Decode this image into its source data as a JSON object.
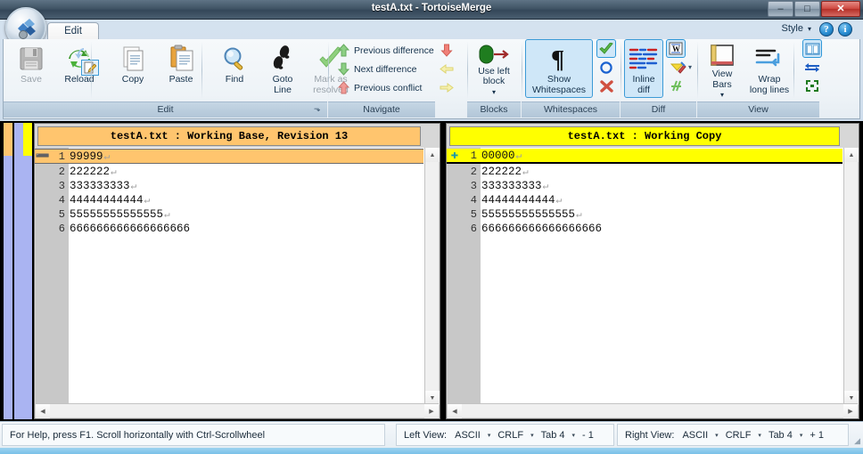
{
  "window": {
    "title": "testA.txt - TortoiseMerge",
    "minimize_label": "–",
    "maximize_label": "□",
    "close_label": "✕",
    "qat_arrow": "▾"
  },
  "tabs": {
    "items": [
      {
        "label": "Edit",
        "active": true
      }
    ],
    "style_label": "Style",
    "style_caret": "▾",
    "help_label": "?",
    "info_label": "i"
  },
  "ribbon": {
    "groups": [
      {
        "name": "edit",
        "label": "Edit",
        "buttons": [
          {
            "name": "save",
            "label": "Save",
            "icon": "floppy-disk-icon",
            "disabled": true
          },
          {
            "name": "reload",
            "label": "Reload",
            "icon": "reload-arrows-icon",
            "disabled": false
          },
          {
            "name": "copy",
            "label": "Copy",
            "icon": "copy-page-icon",
            "disabled": false
          },
          {
            "name": "paste",
            "label": "Paste",
            "icon": "clipboard-icon",
            "disabled": false
          },
          {
            "name": "find",
            "label": "Find",
            "icon": "magnifier-icon",
            "disabled": false
          },
          {
            "name": "goto-line",
            "label": "Goto\nLine",
            "icon": "footsteps-icon",
            "disabled": false
          },
          {
            "name": "mark-resolved",
            "label": "Mark as\nresolved",
            "icon": "green-check-icon",
            "disabled": true
          }
        ],
        "has_dialog_launcher": true,
        "dialog_launcher_glyph": "⬎"
      },
      {
        "name": "navigate",
        "label": "Navigate",
        "rows": [
          {
            "name": "previous-difference",
            "label": "Previous difference",
            "icon": "up-arrow-green-icon",
            "disabled": false
          },
          {
            "name": "next-difference",
            "label": "Next difference",
            "icon": "down-arrow-green-icon",
            "disabled": false
          },
          {
            "name": "previous-conflict",
            "label": "Previous conflict",
            "icon": "up-arrow-red-icon",
            "disabled": false
          }
        ],
        "side_icons": [
          {
            "name": "next-conflict-down",
            "icon": "down-arrow-red-icon",
            "disabled": false
          },
          {
            "name": "previous-inline-diff",
            "icon": "left-arrow-yellow-icon",
            "disabled": true
          },
          {
            "name": "next-inline-diff",
            "icon": "right-arrow-yellow-icon",
            "disabled": true
          }
        ]
      },
      {
        "name": "blocks",
        "label": "Blocks",
        "buttons": [
          {
            "name": "use-left-block",
            "label": "Use left\nblock",
            "icon": "green-pill-arrow-icon",
            "caret": "▾",
            "disabled": false
          }
        ]
      },
      {
        "name": "whitespaces",
        "label": "Whitespaces",
        "buttons": [
          {
            "name": "show-whitespaces",
            "label": "Show\nWhitespaces",
            "icon": "pilcrow-icon",
            "selected": true
          }
        ],
        "side_icons": [
          {
            "name": "ignore-whitespace-none",
            "icon": "green-check-icon",
            "selected": true
          },
          {
            "name": "ignore-whitespace-changes",
            "icon": "blue-circle-icon",
            "selected": false
          },
          {
            "name": "ignore-all-whitespace",
            "icon": "red-x-icon",
            "selected": false
          }
        ]
      },
      {
        "name": "diff",
        "label": "Diff",
        "buttons": [
          {
            "name": "inline-diff",
            "label": "Inline\ndiff",
            "icon": "inline-diff-lines-icon",
            "selected": true
          }
        ],
        "side_icons": [
          {
            "name": "diff-words",
            "icon": "word-document-icon",
            "selected": true
          },
          {
            "name": "highlight-marker",
            "icon": "highlighter-pen-icon",
            "caret": "▾",
            "selected": false
          },
          {
            "name": "diff-script",
            "icon": "green-script-icon",
            "disabled": true
          }
        ]
      },
      {
        "name": "view",
        "label": "View",
        "buttons": [
          {
            "name": "view-bars",
            "label": "View\nBars",
            "icon": "view-bars-icon",
            "caret": "▾"
          },
          {
            "name": "wrap-long-lines",
            "label": "Wrap\nlong lines",
            "icon": "wrap-lines-icon"
          }
        ],
        "side_icons": [
          {
            "name": "two-pane-view",
            "icon": "two-pane-icon",
            "selected": true
          },
          {
            "name": "switch-views",
            "icon": "blue-swap-arrow-icon",
            "selected": false
          },
          {
            "name": "collapse-view",
            "icon": "green-collapse-icon",
            "selected": false
          }
        ]
      }
    ]
  },
  "locator_bars": [
    {
      "name": "left-locator-bar",
      "top_color": "#ffc56e",
      "body_color": "#aab4f2",
      "top_height_pct": 11
    },
    {
      "name": "right-locator-bar",
      "top_color": "#ffff00",
      "body_color": "#aab4f2",
      "top_height_pct": 11
    }
  ],
  "panes": {
    "left": {
      "title": "testA.txt : Working Base, Revision 13",
      "title_bg": "#ffc56e",
      "lines": [
        {
          "num": "1",
          "text": "99999",
          "eol": "↵",
          "marker": "➖",
          "marker_color": "#1a9aa8",
          "highlight": "#ffc56e"
        },
        {
          "num": "2",
          "text": "222222",
          "eol": "↵",
          "marker": "",
          "highlight": ""
        },
        {
          "num": "3",
          "text": "333333333",
          "eol": "↵",
          "marker": "",
          "highlight": ""
        },
        {
          "num": "4",
          "text": "44444444444",
          "eol": "↵",
          "marker": "",
          "highlight": ""
        },
        {
          "num": "5",
          "text": "55555555555555",
          "eol": "↵",
          "marker": "",
          "highlight": ""
        },
        {
          "num": "6",
          "text": "666666666666666666",
          "eol": "",
          "marker": "",
          "highlight": ""
        }
      ]
    },
    "right": {
      "title": "testA.txt : Working Copy",
      "title_bg": "#ffff00",
      "lines": [
        {
          "num": "1",
          "text": "00000",
          "eol": "↵",
          "marker": "✚",
          "marker_color": "#1a9aa8",
          "highlight": "#ffff00"
        },
        {
          "num": "2",
          "text": "222222",
          "eol": "↵",
          "marker": "",
          "highlight": ""
        },
        {
          "num": "3",
          "text": "333333333",
          "eol": "↵",
          "marker": "",
          "highlight": ""
        },
        {
          "num": "4",
          "text": "44444444444",
          "eol": "↵",
          "marker": "",
          "highlight": ""
        },
        {
          "num": "5",
          "text": "55555555555555",
          "eol": "↵",
          "marker": "",
          "highlight": ""
        },
        {
          "num": "6",
          "text": "666666666666666666",
          "eol": "",
          "marker": "",
          "highlight": ""
        }
      ]
    }
  },
  "statusbar": {
    "hint": "For Help, press F1. Scroll horizontally with Ctrl-Scrollwheel",
    "left_view": {
      "label": "Left View:",
      "encoding": "ASCII",
      "line_ending": "CRLF",
      "tab": "Tab 4",
      "count": "- 1",
      "caret": "▾"
    },
    "right_view": {
      "label": "Right View:",
      "encoding": "ASCII",
      "line_ending": "CRLF",
      "tab": "Tab 4",
      "count": "+ 1",
      "caret": "▾"
    },
    "grip": "◢"
  }
}
